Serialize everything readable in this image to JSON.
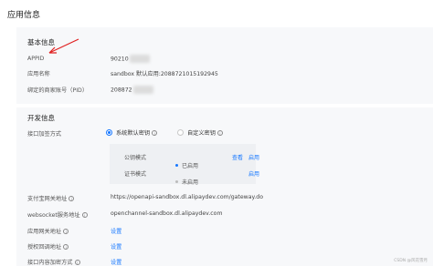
{
  "page": {
    "title": "应用信息"
  },
  "basic": {
    "title": "基本信息",
    "appid_label": "APPID",
    "appid_value": "90210",
    "appname_label": "应用名称",
    "appname_value": "sandbox 默认应用:2088721015192945",
    "pid_label": "绑定的商家账号（PID）",
    "pid_value": "208872"
  },
  "dev": {
    "title": "开发信息",
    "sign_label": "接口加签方式",
    "option_system": "系统默认密钥",
    "option_custom": "自定义密钥",
    "key_rows": [
      {
        "label": "公钥模式",
        "status": "已启用",
        "status_color": "#1677ff",
        "action1": "查看",
        "action2": "启用"
      },
      {
        "label": "证书模式",
        "status": "未启用",
        "status_color": "#bbbbbb",
        "action1": "",
        "action2": "启用"
      }
    ],
    "gateway_label": "支付宝网关地址",
    "gateway_value": "https://openapi-sandbox.dl.alipaydev.com/gateway.do",
    "ws_label": "websocket服务地址",
    "ws_value": "openchannel-sandbox.dl.alipaydev.com",
    "appgw_label": "应用网关地址",
    "appgw_action": "设置",
    "callback_label": "授权回调地址",
    "callback_action": "设置",
    "encrypt_label": "接口内容加密方式",
    "encrypt_action": "设置"
  },
  "footer": {
    "watermark": "CSDN @风花雪月"
  },
  "colors": {
    "accent": "#1677ff",
    "annotation_arrow": "#e02020"
  }
}
